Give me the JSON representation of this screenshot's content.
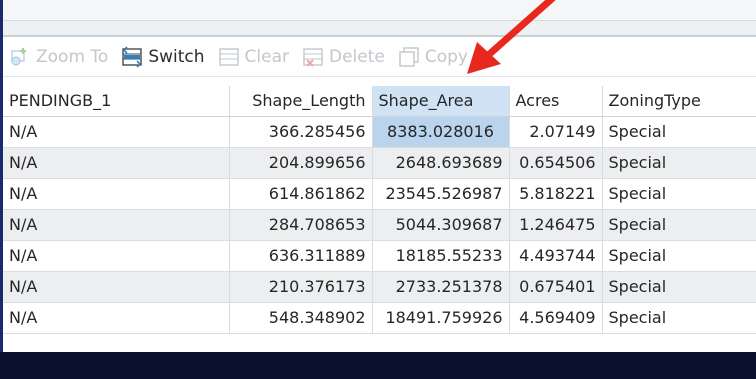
{
  "toolbar": {
    "zoom_to": "Zoom To",
    "switch": "Switch",
    "clear": "Clear",
    "delete": "Delete",
    "copy": "Copy"
  },
  "table": {
    "columns": [
      "PENDINGB_1",
      "Shape_Length",
      "Shape_Area",
      "Acres",
      "ZoningType"
    ],
    "rows": [
      [
        "N/A",
        "366.285456",
        "8383.028016",
        "2.07149",
        "Special"
      ],
      [
        "N/A",
        "204.899656",
        "2648.693689",
        "0.654506",
        "Special"
      ],
      [
        "N/A",
        "614.861862",
        "23545.526987",
        "5.818221",
        "Special"
      ],
      [
        "N/A",
        "284.708653",
        "5044.309687",
        "1.246475",
        "Special"
      ],
      [
        "N/A",
        "636.311889",
        "18185.55233",
        "4.493744",
        "Special"
      ],
      [
        "N/A",
        "210.376173",
        "2733.251378",
        "0.675401",
        "Special"
      ],
      [
        "N/A",
        "548.348902",
        "18491.759926",
        "4.569409",
        "Special"
      ]
    ]
  },
  "colors": {
    "selected_header": "#cfe3f5",
    "selected_cell": "#b9d4ec",
    "alt_row": "#eceef0",
    "arrow": "#e8281e",
    "background": "#0a0f2e"
  }
}
